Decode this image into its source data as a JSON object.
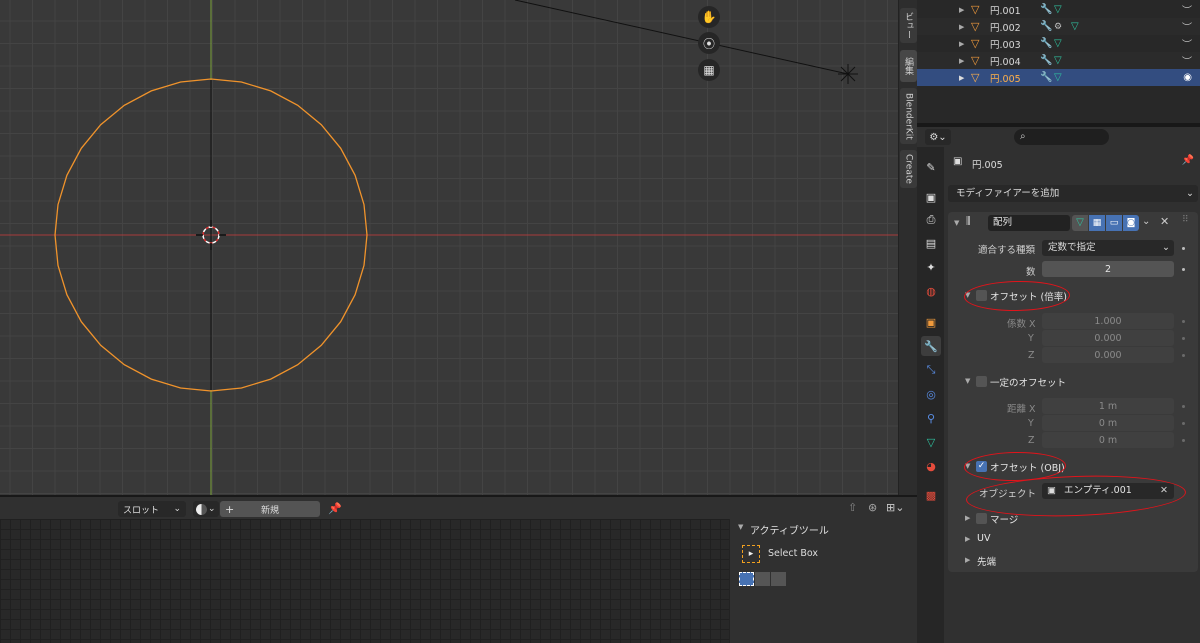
{
  "outliner": {
    "rows": [
      {
        "name": "円.001"
      },
      {
        "name": "円.002"
      },
      {
        "name": "円.003"
      },
      {
        "name": "円.004"
      },
      {
        "name": "円.005"
      }
    ]
  },
  "viewport": {
    "tabs": [
      "ビュー",
      "編集",
      "BlenderKit",
      "Create"
    ]
  },
  "bottom": {
    "slot_label": "スロット",
    "new_label": "新規",
    "plus": "+",
    "tool_panel_title": "アクティブツール",
    "tool_name": "Select Box"
  },
  "properties": {
    "object_name": "円.005",
    "add_modifier": "モディファイアーを追加",
    "modifier_name": "配列",
    "fit_type_label": "適合する種類",
    "fit_type_value": "定数で指定",
    "count_label": "数",
    "count_value": "2",
    "relative_offset": {
      "label": "オフセット (倍率)",
      "checked": false,
      "x_label": "係数 X",
      "x": "1.000",
      "y_label": "Y",
      "y": "0.000",
      "z_label": "Z",
      "z": "0.000"
    },
    "constant_offset": {
      "label": "一定のオフセット",
      "checked": false,
      "x_label": "距離 X",
      "x": "1 m",
      "y_label": "Y",
      "y": "0 m",
      "z_label": "Z",
      "z": "0 m"
    },
    "object_offset": {
      "label": "オフセット (OBJ)",
      "checked": true,
      "object_label": "オブジェクト",
      "object_value": "エンプティ.001"
    },
    "merge_label": "マージ",
    "uv_label": "UV",
    "caps_label": "先端"
  },
  "colors": {
    "selection": "#334d80",
    "mesh_outline": "#f0932b",
    "x_axis": "#b13b3b",
    "y_axis": "#7da53a",
    "annotation": "#e0141b"
  }
}
